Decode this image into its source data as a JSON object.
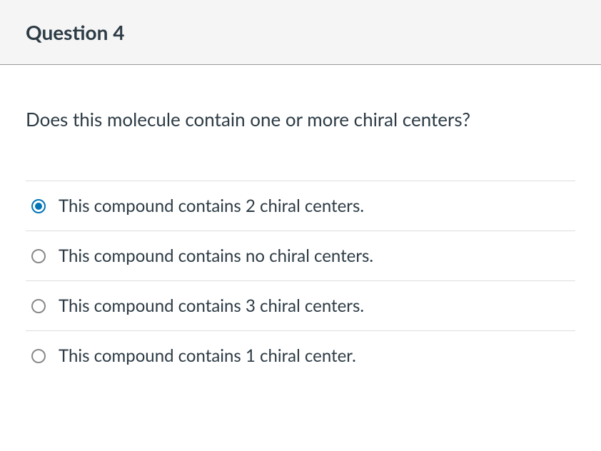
{
  "header": {
    "title": "Question 4"
  },
  "question": {
    "text": "Does this molecule contain one or more chiral centers?"
  },
  "options": [
    {
      "label": "This compound contains 2 chiral centers.",
      "selected": true
    },
    {
      "label": "This compound contains no chiral centers.",
      "selected": false
    },
    {
      "label": "This compound contains 3 chiral centers.",
      "selected": false
    },
    {
      "label": "This compound contains 1 chiral center.",
      "selected": false
    }
  ]
}
